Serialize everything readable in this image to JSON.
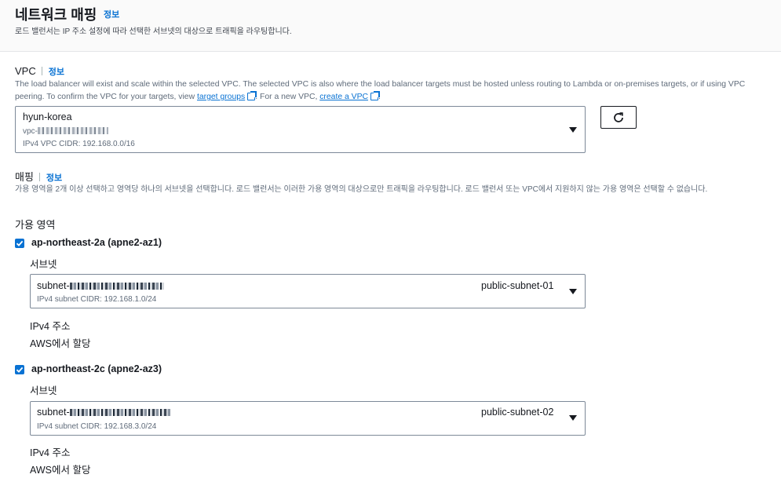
{
  "header": {
    "title": "네트워크 매핑",
    "info": "정보",
    "description": "로드 밸런서는 IP 주소 설정에 따라 선택한 서브넷의 대상으로 트래픽을 라우팅합니다."
  },
  "vpc": {
    "label": "VPC",
    "info": "정보",
    "desc_part1": "The load balancer will exist and scale within the selected VPC. The selected VPC is also where the load balancer targets must be hosted unless routing to Lambda or on-premises targets, or if using VPC peering. To confirm the VPC for your targets, view",
    "target_groups_link": "target groups",
    "desc_part2": ". For a new VPC,",
    "create_vpc_link": "create a VPC",
    "desc_part3": ".",
    "selected_name": "hyun-korea",
    "selected_id_prefix": "vpc-",
    "cidr": "IPv4 VPC CIDR: 192.168.0.0/16"
  },
  "mapping": {
    "label": "매핑",
    "info": "정보",
    "description": "가용 영역을 2개 이상 선택하고 영역당 하나의 서브넷을 선택합니다. 로드 밸런서는 이러한 가용 영역의 대상으로만 트래픽을 라우팅합니다. 로드 밸런서 또는 VPC에서 지원하지 않는 가용 영역은 선택할 수 없습니다.",
    "az_heading": "가용 영역",
    "zones": [
      {
        "name": "ap-northeast-2a (apne2-az1)",
        "checked": true,
        "subnet_label": "서브넷",
        "subnet_id_prefix": "subnet-",
        "subnet_name": "public-subnet-01",
        "subnet_cidr": "IPv4 subnet CIDR: 192.168.1.0/24",
        "ipv4_label": "IPv4 주소",
        "ipv4_value": "AWS에서 할당"
      },
      {
        "name": "ap-northeast-2c (apne2-az3)",
        "checked": true,
        "subnet_label": "서브넷",
        "subnet_id_prefix": "subnet-",
        "subnet_name": "public-subnet-02",
        "subnet_cidr": "IPv4 subnet CIDR: 192.168.3.0/24",
        "ipv4_label": "IPv4 주소",
        "ipv4_value": "AWS에서 할당"
      }
    ]
  },
  "icons": {
    "refresh": "refresh-icon",
    "dropdown": "caret-down-icon",
    "external": "external-link-icon",
    "check": "check-icon"
  },
  "colors": {
    "link": "#0972d3",
    "checkbox": "#0972d3",
    "text": "#16191f",
    "muted": "#5f6b7a"
  }
}
